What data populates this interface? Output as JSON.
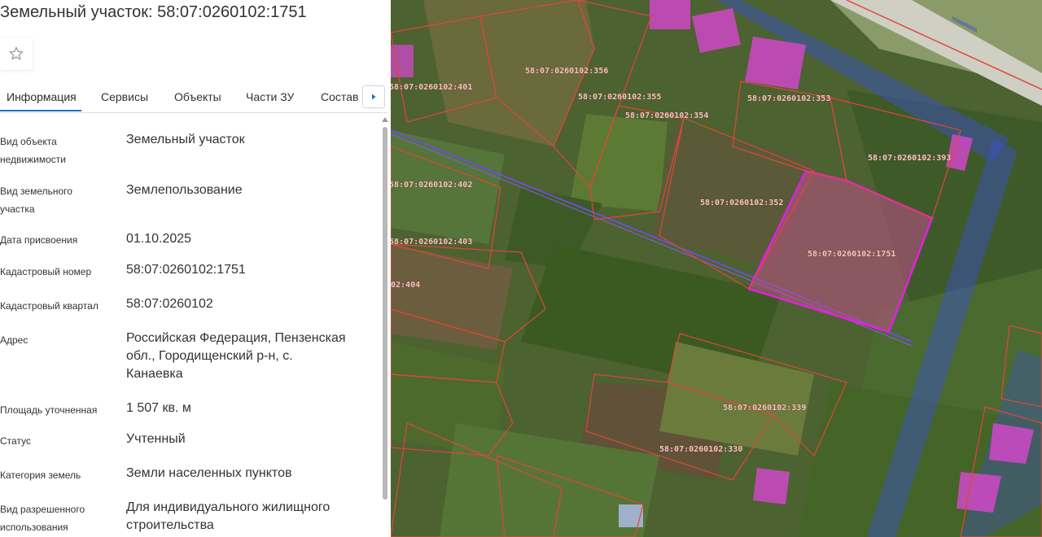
{
  "header": {
    "title": "Земельный участок: 58:07:0260102:1751"
  },
  "tabs": [
    {
      "label": "Информация",
      "active": true
    },
    {
      "label": "Сервисы",
      "active": false
    },
    {
      "label": "Объекты",
      "active": false
    },
    {
      "label": "Части ЗУ",
      "active": false
    },
    {
      "label": "Состав",
      "active": false
    }
  ],
  "info": [
    {
      "label_lines": [
        "Вид объекта",
        "недвижимости"
      ],
      "value_lines": [
        "Земельный участок"
      ]
    },
    {
      "label_lines": [
        "Вид земельного",
        "участка"
      ],
      "value_lines": [
        "Землепользование"
      ]
    },
    {
      "label_lines": [
        "Дата присвоения"
      ],
      "value_lines": [
        "01.10.2025"
      ]
    },
    {
      "label_lines": [
        "Кадастровый номер"
      ],
      "value_lines": [
        "58:07:0260102:1751"
      ]
    },
    {
      "label_lines": [
        "Кадастровый квартал"
      ],
      "value_lines": [
        "58:07:0260102"
      ]
    },
    {
      "label_lines": [
        "Адрес"
      ],
      "value_lines": [
        "Российская Федерация, Пензенская",
        "обл., Городищенский р-н, с.",
        "Канаевка"
      ]
    },
    {
      "label_lines": [
        "Площадь уточненная"
      ],
      "value_lines": [
        "1 507 кв. м"
      ]
    },
    {
      "label_lines": [
        "Статус"
      ],
      "value_lines": [
        "Учтенный"
      ]
    },
    {
      "label_lines": [
        "Категория земель"
      ],
      "value_lines": [
        "Земли населенных пунктов"
      ]
    },
    {
      "label_lines": [
        "Вид разрешенного",
        "использования"
      ],
      "value_lines": [
        "Для индивидуального жилищного",
        "строительства"
      ]
    }
  ],
  "map": {
    "parcel_labels": [
      "58:07:0260102:356",
      "58:07:0260102:355",
      "58:07:0260102:354",
      "58:07:0260102:353",
      "58:07:0260102:393",
      "58:07:0260102:352",
      "58:07:0260102:1751",
      "58:07:0260102:401",
      "58:07:0260102:402",
      "58:07:0260102:403",
      "02:404",
      "58:07:0260102:339",
      "58:07:0260102:330"
    ],
    "colors": {
      "selected_fill": "#c0508a",
      "boundary_red": "#e0463a",
      "block_blue": "#3a4fd0",
      "building_magenta": "#d048c8"
    }
  },
  "icons": {
    "favorite": "star-outline-icon",
    "tabs_next": "caret-right-icon"
  }
}
